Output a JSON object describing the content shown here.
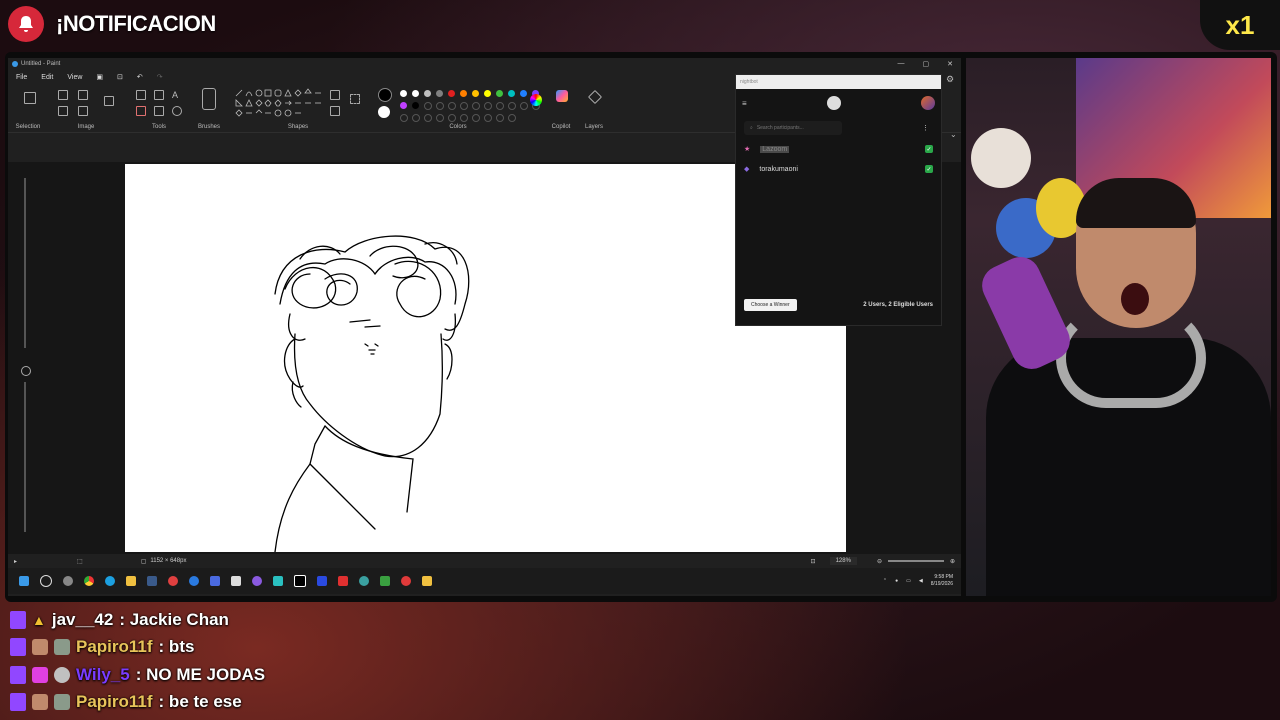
{
  "overlay": {
    "alert_label": "¡NOTIFICACION",
    "multiplier": "x1"
  },
  "paint": {
    "title": "Untitled - Paint",
    "menu": [
      "File",
      "Edit",
      "View"
    ],
    "groups": {
      "selection": "Selection",
      "image": "Image",
      "tools": "Tools",
      "brushes": "Brushes",
      "shapes": "Shapes",
      "colors": "Colors",
      "copilot": "Copilot",
      "layers": "Layers"
    },
    "palette": [
      "#ffffff",
      "#ffffff",
      "#c0c0c0",
      "#808080",
      "#e02020",
      "#ff8000",
      "#ffc000",
      "#ffff00",
      "#40c040",
      "#00c0c0",
      "#2080ff",
      "#8040ff",
      "#c040ff",
      "#000000"
    ],
    "status": {
      "dimensions": "1152 × 648px",
      "zoom": "128%"
    }
  },
  "taskbar": {
    "time": "9:58 PM",
    "date": "8/19/2026"
  },
  "picker": {
    "title": "nightbot",
    "search_placeholder": "Search participants...",
    "participants": [
      {
        "name": "Lazoom",
        "checked": true
      },
      {
        "name": "torakumaoni",
        "checked": true
      }
    ],
    "winner_button": "Choose a Winner",
    "summary": "2 Users, 2 Eligible Users"
  },
  "chat": [
    {
      "user": "jav__42",
      "text": ": Jackie Chan",
      "color": "#ffffff"
    },
    {
      "user": "Papiro11f",
      "text": ": bts",
      "color": "#e8c45a"
    },
    {
      "user": "Wily_5",
      "text": ": NO ME JODAS",
      "color": "#7a3cff"
    },
    {
      "user": "Papiro11f",
      "text": ": be te ese",
      "color": "#e8c45a"
    }
  ]
}
